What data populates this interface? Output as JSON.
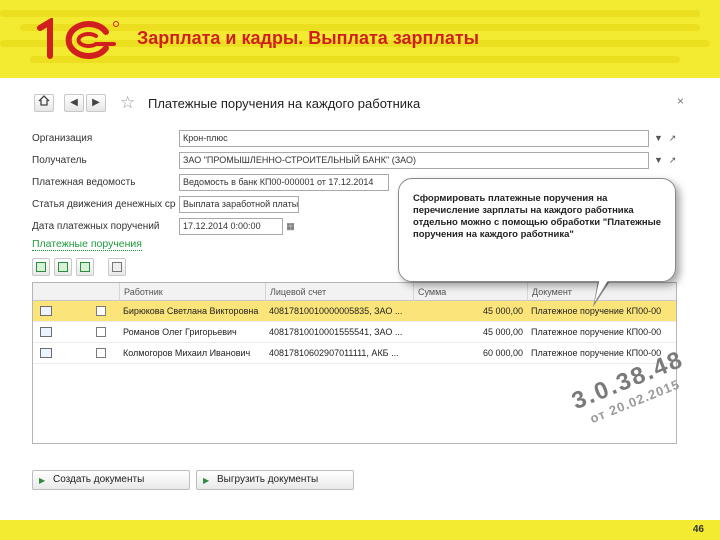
{
  "slide": {
    "title": "Зарплата и кадры. Выплата зарплаты",
    "page_number": "46",
    "colors": {
      "brand_yellow": "#f3ea32",
      "logo_red": "#d11f1f",
      "link_green": "#1f9a3a",
      "row_highlight": "#fbe57a"
    }
  },
  "window": {
    "title": "Платежные поручения на каждого работника",
    "nav": {
      "home_icon": "home-icon",
      "back_icon": "back-arrow-icon",
      "forward_icon": "forward-arrow-icon",
      "favorite_icon": "star-icon",
      "close_icon": "close-icon"
    }
  },
  "form": {
    "fields": [
      {
        "label": "Организация",
        "value": "Крон-плюс"
      },
      {
        "label": "Получатель",
        "value": "ЗАО \"ПРОМЫШЛЕННО-СТРОИТЕЛЬНЫЙ БАНК\" (ЗАО)"
      },
      {
        "label": "Платежная ведомость",
        "value": "Ведомость в банк КП00-000001 от 17.12.2014"
      },
      {
        "label": "Статья движения денежных средств",
        "value": "Выплата заработной платы работникам"
      },
      {
        "label": "Дата платежных поручений",
        "value": "17.12.2014 0:00:00"
      }
    ],
    "section_link": "Платежные поручения"
  },
  "table": {
    "columns": [
      "",
      "Работник",
      "Лицевой счет",
      "Сумма",
      "Документ"
    ],
    "rows": [
      {
        "employee": "Бирюкова Светлана Викторовна",
        "account": "40817810010000005835, ЗАО ...",
        "amount": "45 000,00",
        "document": "Платежное поручение КП00-00"
      },
      {
        "employee": "Романов Олег Григорьевич",
        "account": "40817810010001555541, ЗАО ...",
        "amount": "45 000,00",
        "document": "Платежное поручение КП00-00"
      },
      {
        "employee": "Колмогоров Михаил Иванович",
        "account": "40817810602907011111, АКБ ...",
        "amount": "60 000,00",
        "document": "Платежное поручение КП00-00"
      }
    ]
  },
  "callout": {
    "text": "Сформировать платежные поручения на перечисление зарплаты на каждого работника отдельно можно с помощью обработки \"Платежные поручения на каждого работника\""
  },
  "buttons": {
    "create_documents": "Создать документы",
    "upload_documents": "Выгрузить документы"
  },
  "stamp": {
    "version": "3.0.38.48",
    "date": "от 20.02.2015"
  }
}
